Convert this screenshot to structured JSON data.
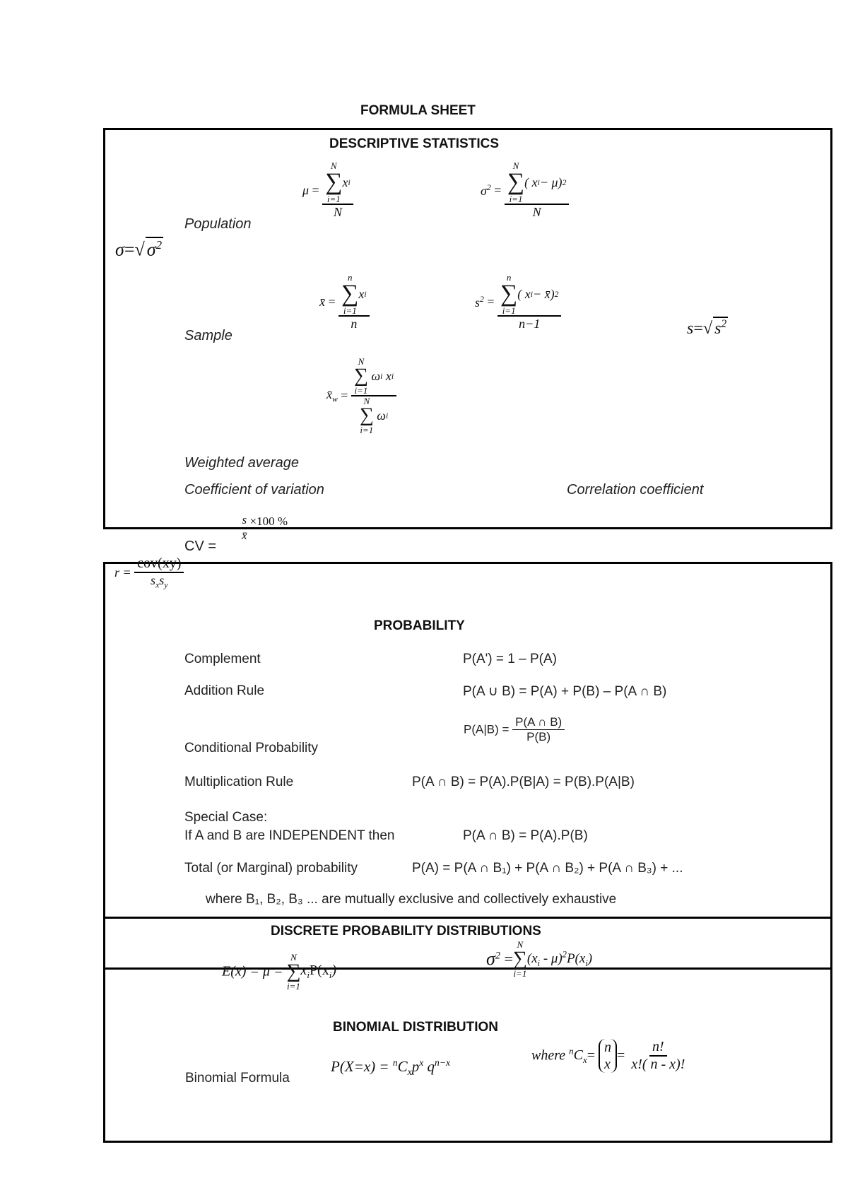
{
  "title": "FORMULA SHEET",
  "descriptive": {
    "heading": "DESCRIPTIVE STATISTICS",
    "population_label": "Population",
    "sample_label": "Sample",
    "weighted_label": "Weighted average",
    "cv_label": "Coefficient of variation",
    "corr_label": "Correlation coefficient",
    "sigma_sqrt": {
      "lhs": "σ",
      "eq": "=",
      "rad": "σ",
      "exp": "2"
    },
    "pop_mean": {
      "lhs": "μ",
      "eq": "=",
      "sum_top": "N",
      "sum_bot": "i=1",
      "term": "x",
      "sub": "i",
      "den": "N"
    },
    "pop_var": {
      "lhs": "σ",
      "exp": "2",
      "eq": "=",
      "sum_top": "N",
      "sum_bot": "i=1",
      "term": "( x",
      "sub": "i",
      "rest": " − μ)",
      "rest_exp": "2",
      "den": "N"
    },
    "samp_mean": {
      "lhs": "x̄",
      "eq": "=",
      "sum_top": "n",
      "sum_bot": "i=1",
      "term": "x",
      "sub": "i",
      "den": "n"
    },
    "samp_var": {
      "lhs": "s",
      "exp": "2",
      "eq": "=",
      "sum_top": "n",
      "sum_bot": "i=1",
      "term": "( x",
      "sub": "i",
      "rest": " − x̄)",
      "rest_exp": "2",
      "den": "n−1"
    },
    "samp_sd": {
      "lhs": "s",
      "eq": "=",
      "rad": "s",
      "exp": "2"
    },
    "weighted": {
      "lhs": "x̄",
      "lhs_sub": "w",
      "eq": "=",
      "num_top": "N",
      "num_bot": "i=1",
      "num_term": "ω",
      "num_sub": "i",
      "num_term2": "x",
      "num_sub2": "i",
      "den_top": "N",
      "den_bot": "i=1",
      "den_term": "ω",
      "den_sub": "i"
    },
    "cv": {
      "lhs": "CV =",
      "num": "s",
      "den": "x̄",
      "tail": "×100 %"
    },
    "corr": {
      "lhs": "r =",
      "num": "cov(xy)",
      "den_s1": "s",
      "den_sub1": "x",
      "den_s2": "s",
      "den_sub2": "y"
    }
  },
  "probability": {
    "heading": "PROBABILITY",
    "rows": [
      {
        "label": "Complement",
        "formula": "P(A') = 1 – P(A)"
      },
      {
        "label": "Addition Rule",
        "formula": "P(A ∪ B) = P(A) + P(B) – P(A ∩ B)"
      },
      {
        "label": "Conditional Probability",
        "lhs": "P(A|B) =",
        "num": "P(A  ∩  B)",
        "den": "P(B)"
      },
      {
        "label": "Multiplication Rule",
        "formula": "P(A ∩ B) = P(A).P(B|A)  =   P(B).P(A|B)"
      },
      {
        "label": "Special Case:",
        "label2": "If A and B are INDEPENDENT then",
        "formula": "P(A ∩ B) = P(A).P(B)"
      },
      {
        "label": "Total (or Marginal) probability",
        "formula": "P(A) = P(A ∩ B₁) + P(A ∩ B₂) + P(A ∩ B₃) + ..."
      }
    ],
    "note": "where B₁, B₂, B₃   ...  are mutually exclusive and collectively exhaustive"
  },
  "discrete": {
    "heading": "DISCRETE PROBABILITY DISTRIBUTIONS",
    "expectation": {
      "lhs": "E(x) = μ =",
      "sum_top": "N",
      "sum_bot": "i=1",
      "term": "x",
      "sub": "i",
      "tail": "P(x",
      "tail_sub": "i",
      "close": ")"
    },
    "variance": {
      "lhs": "σ",
      "exp": "2",
      "eq": "=",
      "sum_top": "N",
      "sum_bot": "i=1",
      "term": "(x",
      "sub": "i",
      "mid": " - μ)",
      "mid_exp": "2",
      "tail": "P(x",
      "tail_sub": "i",
      "close": ")"
    }
  },
  "binomial": {
    "heading": "BINOMIAL DISTRIBUTION",
    "label": "Binomial Formula",
    "formula": {
      "lhs": "P(X=x)  =",
      "n": "n",
      "C": "C",
      "x": "x",
      "p": "p",
      "pexp": "x",
      "q": "q",
      "qexp": "n−x"
    },
    "where": {
      "word": "where",
      "n": "n",
      "C": "C",
      "x": "x",
      "eq": "=",
      "top": "n",
      "bot": "x",
      "eq2": "=",
      "num": "n!",
      "den": "x!( n - x)!"
    }
  }
}
